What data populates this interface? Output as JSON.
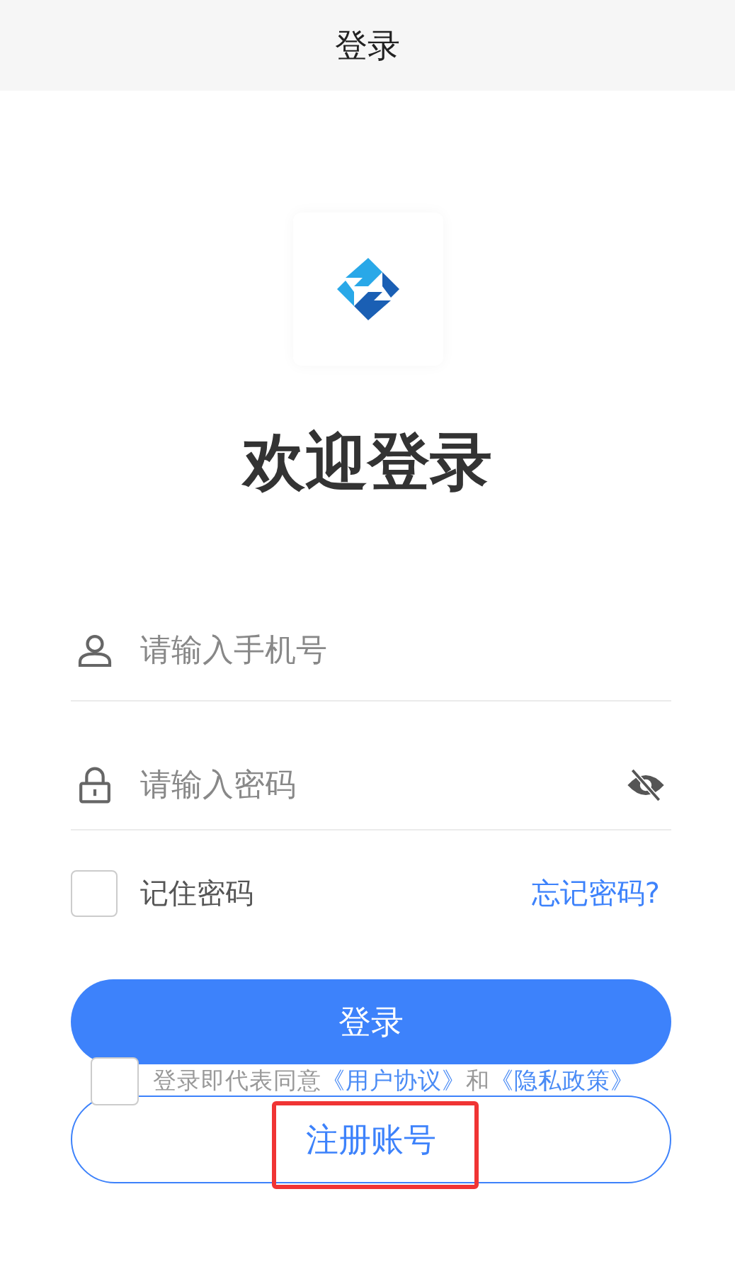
{
  "header": {
    "title": "登录"
  },
  "logo": {
    "kind": "app-logo"
  },
  "heading": "欢迎登录",
  "fields": [
    {
      "kind": "phone",
      "placeholder": "请输入手机号"
    },
    {
      "kind": "password",
      "placeholder": "请输入密码",
      "password_visible": false
    }
  ],
  "remember": {
    "label": "记住密码",
    "checked": false
  },
  "forgot_link": "忘记密码?",
  "login_button": "登录",
  "agreement": {
    "checked": false,
    "text": "登录即代表同意",
    "link_1": "《用户协议》",
    "joiner": "和",
    "link_2": "《隐私政策》"
  },
  "register_button": {
    "label": "注册账号",
    "highlighted": true
  }
}
